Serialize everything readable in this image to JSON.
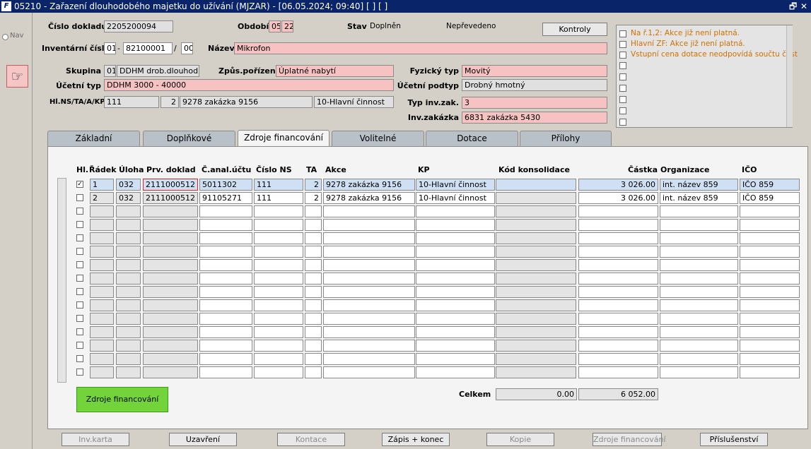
{
  "window": {
    "title": "05210 - Zařazení dlouhodobého majetku do užívání (MJZAR) - [06.05.2024; 09:40] [ ] [ ]",
    "logo": "F",
    "restore_glyph": "🗗",
    "close_glyph": "✕"
  },
  "nav": {
    "label": "Nav",
    "icon": "hand-pointer-icon",
    "icon_glyph": "☞"
  },
  "form": {
    "cislo_dokladu_label": "Číslo dokladu",
    "cislo_dokladu": "2205200094",
    "obdobi_label": "Období",
    "obdobi_1": "05",
    "obdobi_2": "22",
    "stav_label": "Stav",
    "stav": "Doplněn",
    "stav2": "Nepřevedeno",
    "kontroly_button": "Kontroly",
    "inv_cislo_label": "Inventární číslo",
    "inv_1": "01",
    "inv_dash": "-",
    "inv_2": "82100001",
    "inv_slash": "/",
    "inv_3": "00",
    "nazev_label": "Název",
    "nazev": "Mikrofon",
    "skupina_label": "Skupina",
    "skupina_kod": "01",
    "skupina": "DDHM drob.dlouhod.hm",
    "zpusob_label": "Způs.pořízení",
    "zpusob": "Úplatné nabytí",
    "fyzicky_label": "Fyzický typ",
    "fyzicky": "Movitý",
    "ucetni_typ_label": "Účetní typ",
    "ucetni_typ": "DDHM 3000 - 40000",
    "ucetni_podtyp_label": "Účetní podtyp",
    "ucetni_podtyp": "Drobný hmotný",
    "hlns_label": "Hl.NS/TA/A/KP",
    "hlns": "111",
    "ta": "2",
    "akce": "9278 zakázka 9156",
    "kp": "10-Hlavní činnost",
    "typ_inv_label": "Typ inv.zak.",
    "typ_inv": "3",
    "inv_zakazka_label": "Inv.zakázka",
    "inv_zakazka": "6831 zakázka 5430"
  },
  "messages": [
    "Na ř.1,2: Akce již není platná.",
    "Hlavní ZF: Akce již není platná.",
    "Vstupní cena dotace neodpovídá součtu část"
  ],
  "tabs": [
    "Základní",
    "Doplňkové",
    "Zdroje financování",
    "Volitelné",
    "Dotace",
    "Přílohy"
  ],
  "table": {
    "headers": {
      "hl": "Hl.",
      "radek": "Řádek",
      "uloha": "Úloha",
      "prv": "Prv. doklad",
      "canal": "Č.anal.účtu",
      "cislons": "Číslo NS",
      "ta": "TA",
      "akce": "Akce",
      "kp": "KP",
      "kod": "Kód konsolidace",
      "castka": "Částka",
      "org": "Organizace",
      "ico": "IČO"
    },
    "rows": [
      {
        "hl": "✓",
        "radek": "1",
        "uloha": "032",
        "prv": "2111000512",
        "canal": "5011302",
        "cislons": "111",
        "ta": "2",
        "akce": "9278 zakázka 9156",
        "kp": "10-Hlavní činnost",
        "kod": "",
        "castka": "3 026.00",
        "org": "int. název 859",
        "ico": "IČO 859"
      },
      {
        "hl": "",
        "radek": "2",
        "uloha": "032",
        "prv": "2111000512",
        "canal": "91105271",
        "cislons": "111",
        "ta": "2",
        "akce": "9278 zakázka 9156",
        "kp": "10-Hlavní činnost",
        "kod": "",
        "castka": "3 026.00",
        "org": "int. název 859",
        "ico": "IČO 859"
      }
    ],
    "empty_row_count": 13
  },
  "zdroje_button": "Zdroje financování",
  "celkem_label": "Celkem",
  "celkem_1": "0.00",
  "celkem_2": "6 052.00",
  "bottom_buttons": [
    {
      "label": "Inv.karta",
      "enabled": false
    },
    {
      "label": "Uzavření",
      "enabled": true
    },
    {
      "label": "Kontace",
      "enabled": false
    },
    {
      "label": "Zápis + konec",
      "enabled": true
    },
    {
      "label": "Kopie",
      "enabled": false
    },
    {
      "label": "Zdroje financování",
      "enabled": false
    },
    {
      "label": "Příslušenství",
      "enabled": true
    }
  ]
}
